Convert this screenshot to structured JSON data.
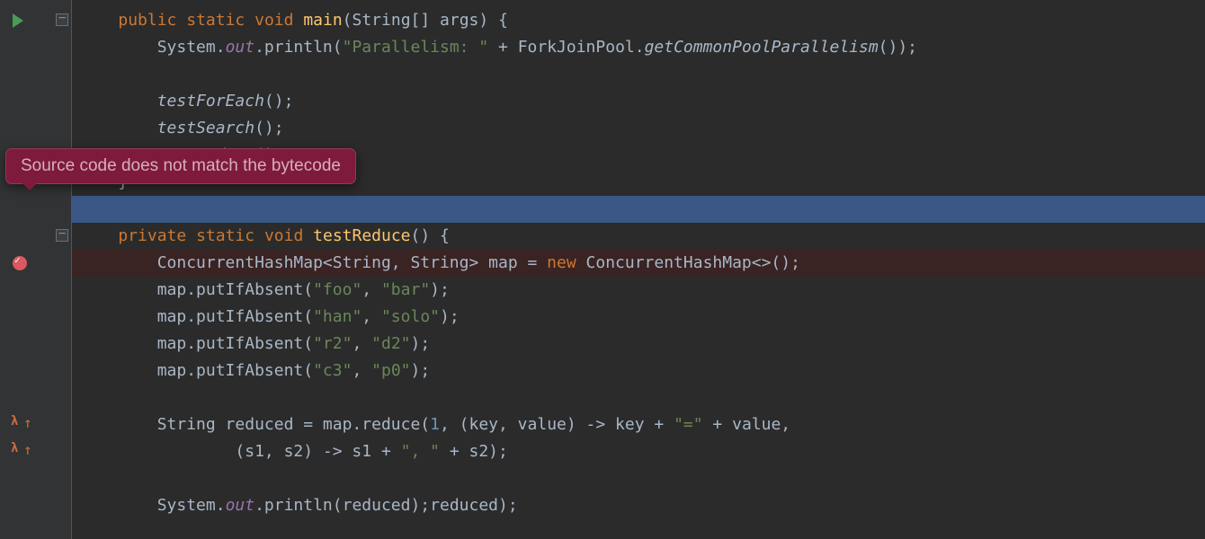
{
  "tooltip": {
    "text": "Source code does not match the bytecode"
  },
  "code": {
    "l1_public": "public",
    "l1_static": "static",
    "l1_void": "void",
    "l1_main": "main",
    "l1_tail": "(String[] args) {",
    "l2_pre": "        System.",
    "l2_out": "out",
    "l2_print": ".println(",
    "l2_str": "\"Parallelism: \"",
    "l2_plus": " + ForkJoinPool.",
    "l2_call": "getCommonPoolParallelism",
    "l2_end": "());",
    "l4_call": "        testForEach",
    "l4_end": "();",
    "l5_call": "        testSearch",
    "l5_end": "();",
    "l6_call": "        testReduce",
    "l6_end": "();",
    "l7": "    }",
    "l9_private": "private",
    "l9_static": "static",
    "l9_void": "void",
    "l9_method": "testReduce",
    "l9_tail": "() {",
    "l10_pre": "        ConcurrentHashMap<String, String> map = ",
    "l10_new": "new",
    "l10_tail": " ConcurrentHashMap<>();",
    "l11_pre": "        map.putIfAbsent(",
    "l11_s1": "\"foo\"",
    "l11_c": ", ",
    "l11_s2": "\"bar\"",
    "l11_end": ");",
    "l12_pre": "        map.putIfAbsent(",
    "l12_s1": "\"han\"",
    "l12_c": ", ",
    "l12_s2": "\"solo\"",
    "l12_end": ");",
    "l13_pre": "        map.putIfAbsent(",
    "l13_s1": "\"r2\"",
    "l13_c": ", ",
    "l13_s2": "\"d2\"",
    "l13_end": ");",
    "l14_pre": "        map.putIfAbsent(",
    "l14_s1": "\"c3\"",
    "l14_c": ", ",
    "l14_s2": "\"p0\"",
    "l14_end": ");",
    "l16_pre": "        String reduced = map.reduce(",
    "l16_num": "1",
    "l16_mid": ", (key, value) -> key + ",
    "l16_str": "\"=\"",
    "l16_end": " + value,",
    "l17_pre": "                (s1, s2) -> s1 + ",
    "l17_str": "\", \"",
    "l17_end": " + s2);",
    "l19_pre": "        System.",
    "l19_out": "out",
    "l19_print": ".println(reduced);"
  },
  "icons": {
    "run": "run-icon",
    "fold": "fold-icon",
    "breakpoint": "breakpoint-icon",
    "lambda": "lambda-step-icon"
  }
}
